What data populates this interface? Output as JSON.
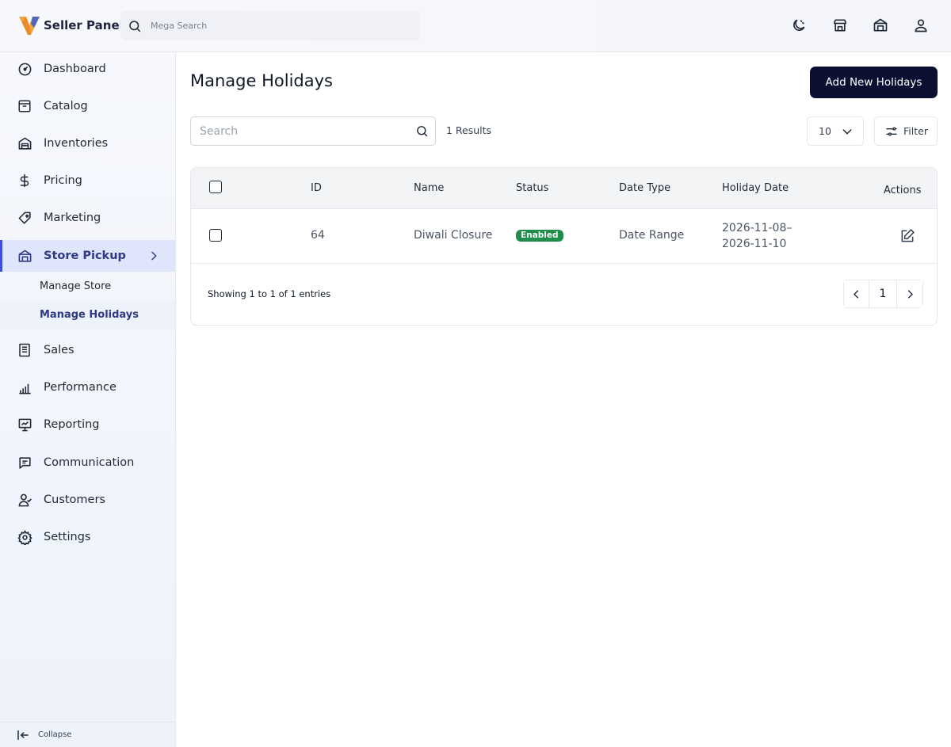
{
  "header": {
    "brand": "Seller Panel",
    "search_placeholder": "Mega Search",
    "icons": [
      "moon-icon",
      "store-icon",
      "warehouse-icon",
      "user-icon"
    ]
  },
  "sidebar": {
    "items": [
      {
        "label": "Dashboard",
        "icon": "dashboard-icon"
      },
      {
        "label": "Catalog",
        "icon": "catalog-icon"
      },
      {
        "label": "Inventories",
        "icon": "inventory-icon"
      },
      {
        "label": "Pricing",
        "icon": "dollar-icon"
      },
      {
        "label": "Marketing",
        "icon": "tag-icon"
      },
      {
        "label": "Store Pickup",
        "icon": "store-icon",
        "active": true
      },
      {
        "label": "Sales",
        "icon": "receipt-icon"
      },
      {
        "label": "Performance",
        "icon": "chart-icon"
      },
      {
        "label": "Reporting",
        "icon": "presentation-icon"
      },
      {
        "label": "Communication",
        "icon": "message-icon"
      },
      {
        "label": "Customers",
        "icon": "customers-icon"
      },
      {
        "label": "Settings",
        "icon": "gear-icon"
      }
    ],
    "sub_items": [
      {
        "label": "Manage Store"
      },
      {
        "label": "Manage Holidays",
        "active": true
      }
    ],
    "collapse_label": "Collapse"
  },
  "main": {
    "title": "Manage Holidays",
    "add_button": "Add New Holidays",
    "search_placeholder": "Search",
    "results": "1 Results",
    "per_page": "10",
    "filter_label": "Filter",
    "columns": [
      "ID",
      "Name",
      "Status",
      "Date Type",
      "Holiday Date",
      "Actions"
    ],
    "rows": [
      {
        "id": "64",
        "name": "Diwali Closure",
        "status": "Enabled",
        "date_type": "Date Range",
        "date_line1": "2026-11-08–",
        "date_line2": "2026-11-10"
      }
    ],
    "showing": "Showing 1 to 1 of 1 entries",
    "current_page": "1"
  },
  "colors": {
    "primary_button": "#0b1033",
    "active_nav": "#2e3a86",
    "enabled_badge": "#1e8e4a"
  }
}
